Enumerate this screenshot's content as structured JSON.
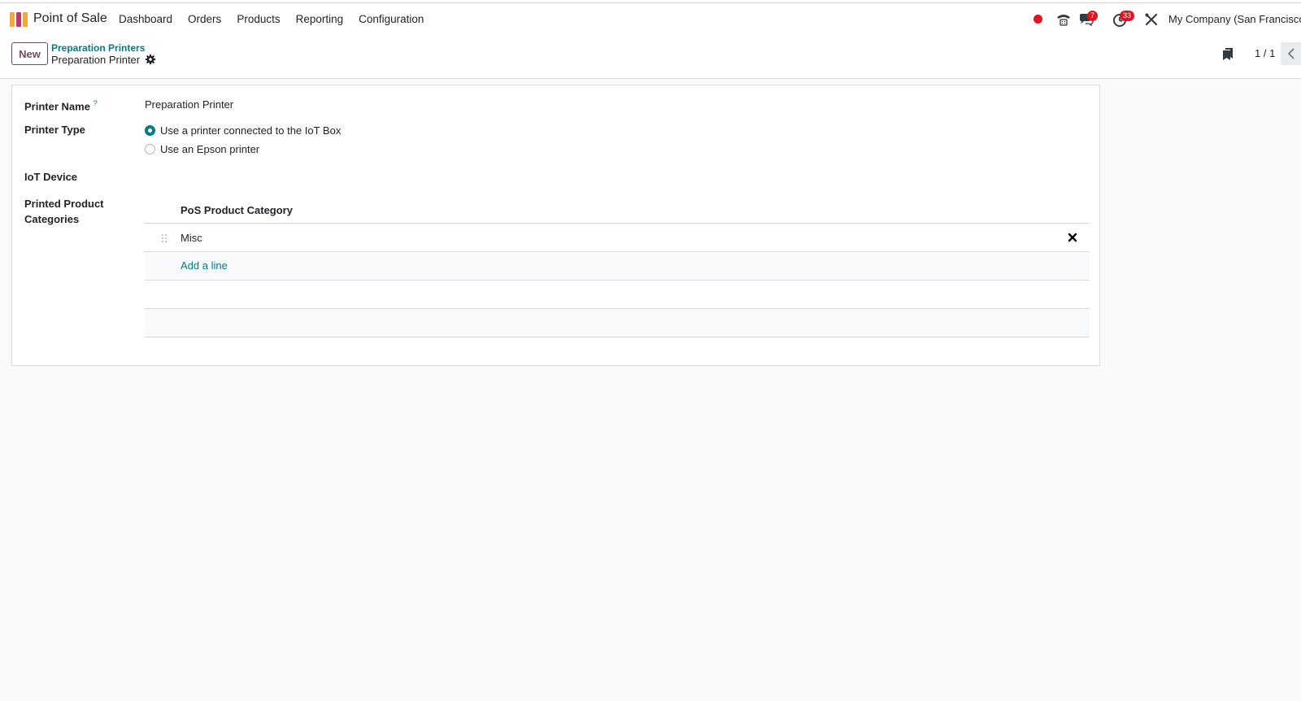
{
  "navbar": {
    "app_name": "Point of Sale",
    "menu": [
      {
        "label": "Dashboard"
      },
      {
        "label": "Orders"
      },
      {
        "label": "Products"
      },
      {
        "label": "Reporting"
      },
      {
        "label": "Configuration"
      }
    ],
    "messages_badge": "7",
    "activities_badge": "33",
    "company": "My Company (San Francisco)"
  },
  "control_panel": {
    "new_label": "New",
    "breadcrumb_parent": "Preparation Printers",
    "breadcrumb_current": "Preparation Printer",
    "pager": "1 / 1"
  },
  "form": {
    "printer_name_label": "Printer Name",
    "printer_name_help": "?",
    "printer_name_value": "Preparation Printer",
    "printer_type_label": "Printer Type",
    "printer_type_options": [
      {
        "label": "Use a printer connected to the IoT Box",
        "checked": true
      },
      {
        "label": "Use an Epson printer",
        "checked": false
      }
    ],
    "iot_device_label": "IoT Device",
    "categories_label_line1": "Printed Product",
    "categories_label_line2": "Categories",
    "categories_table": {
      "column_header": "PoS Product Category",
      "rows": [
        "Misc"
      ],
      "add_line": "Add a line"
    }
  },
  "colors": {
    "brand": "#714b67",
    "accent": "#017e84",
    "badge": "#e0141e",
    "background": "#f9fafb"
  },
  "icons": [
    "app-logo",
    "record-dot-icon",
    "phone-icon",
    "chat-icon",
    "clock-icon",
    "tools-icon",
    "gear-icon",
    "bookmark-icon",
    "chevron-left-icon",
    "drag-handle-icon",
    "delete-x-icon"
  ]
}
